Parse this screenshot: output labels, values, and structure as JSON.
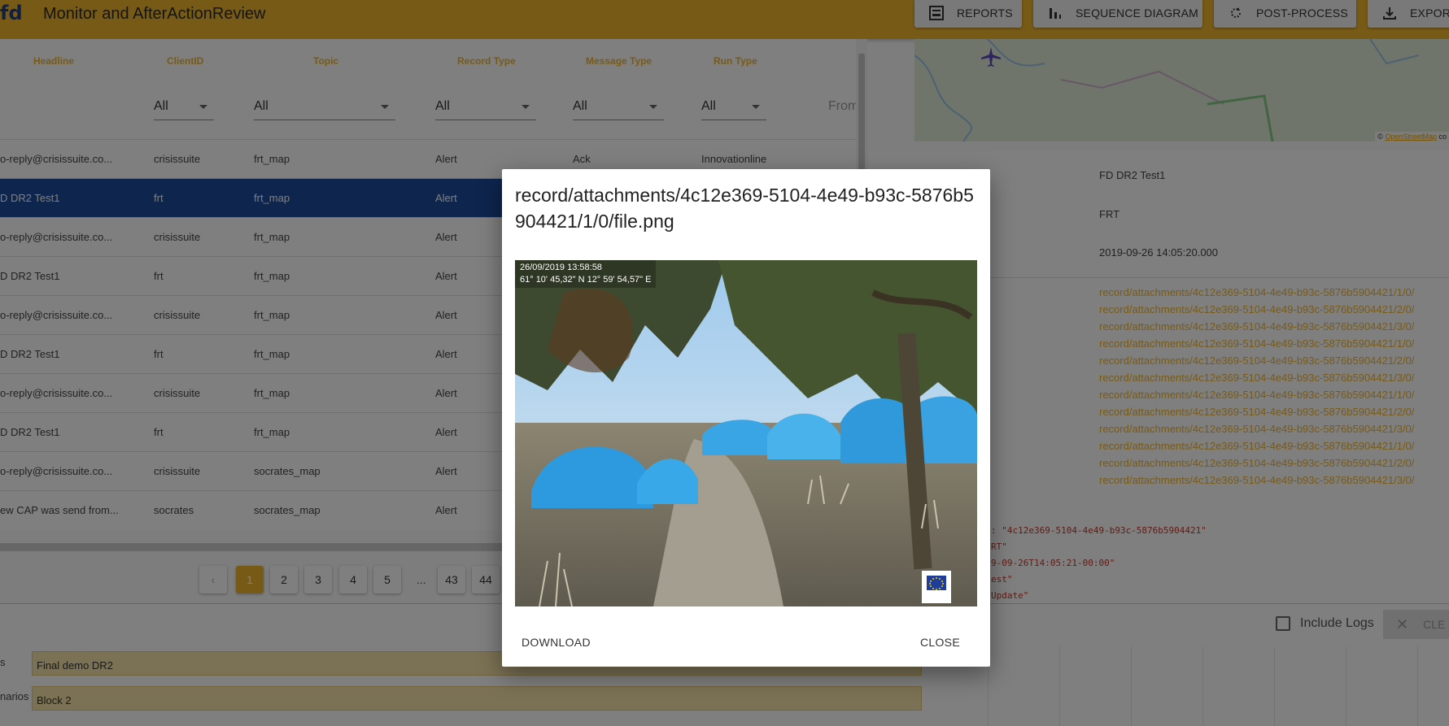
{
  "app": {
    "logo_text": "fd",
    "title": "Monitor and AfterActionReview"
  },
  "toolbar": {
    "reports": "REPORTS",
    "sequence_diagram": "SEQUENCE DIAGRAM",
    "post_process": "POST-PROCESS",
    "export": "EXPOR"
  },
  "table": {
    "columns": [
      "Headline",
      "ClientID",
      "Topic",
      "Record Type",
      "Message Type",
      "Run Type"
    ],
    "filters": {
      "clientid": "All",
      "topic": "All",
      "record_type": "All",
      "message_type": "All",
      "run_type": "All",
      "from": "From"
    },
    "rows": [
      {
        "headline": "o-reply@crisissuite.co...",
        "clientid": "crisissuite",
        "topic": "frt_map",
        "record_type": "Alert",
        "message_type": "Ack",
        "run_type": "Innovationline"
      },
      {
        "headline": "D DR2 Test1",
        "clientid": "frt",
        "topic": "frt_map",
        "record_type": "Alert",
        "message_type": "",
        "run_type": ""
      },
      {
        "headline": "o-reply@crisissuite.co...",
        "clientid": "crisissuite",
        "topic": "frt_map",
        "record_type": "Alert",
        "message_type": "",
        "run_type": ""
      },
      {
        "headline": "D DR2 Test1",
        "clientid": "frt",
        "topic": "frt_map",
        "record_type": "Alert",
        "message_type": "",
        "run_type": ""
      },
      {
        "headline": "o-reply@crisissuite.co...",
        "clientid": "crisissuite",
        "topic": "frt_map",
        "record_type": "Alert",
        "message_type": "",
        "run_type": ""
      },
      {
        "headline": "D DR2 Test1",
        "clientid": "frt",
        "topic": "frt_map",
        "record_type": "Alert",
        "message_type": "",
        "run_type": ""
      },
      {
        "headline": "o-reply@crisissuite.co...",
        "clientid": "crisissuite",
        "topic": "frt_map",
        "record_type": "Alert",
        "message_type": "",
        "run_type": ""
      },
      {
        "headline": "D DR2 Test1",
        "clientid": "frt",
        "topic": "frt_map",
        "record_type": "Alert",
        "message_type": "",
        "run_type": ""
      },
      {
        "headline": "o-reply@crisissuite.co...",
        "clientid": "crisissuite",
        "topic": "socrates_map",
        "record_type": "Alert",
        "message_type": "",
        "run_type": ""
      },
      {
        "headline": "ew CAP was send from...",
        "clientid": "socrates",
        "topic": "socrates_map",
        "record_type": "Alert",
        "message_type": "",
        "run_type": ""
      }
    ]
  },
  "pagination": {
    "prev": "‹",
    "pages": [
      "1",
      "2",
      "3",
      "4",
      "5",
      "...",
      "43",
      "44"
    ],
    "active": "1"
  },
  "timeline": {
    "labels": [
      "s",
      "narios"
    ],
    "bars": [
      "Final demo DR2",
      "Block 2"
    ]
  },
  "details": {
    "name": "FD DR2 Test1",
    "client": "FRT",
    "timestamp": "2019-09-26 14:05:20.000",
    "attachments": [
      "record/attachments/4c12e369-5104-4e49-b93c-5876b5904421/1/0/",
      "record/attachments/4c12e369-5104-4e49-b93c-5876b5904421/2/0/",
      "record/attachments/4c12e369-5104-4e49-b93c-5876b5904421/3/0/",
      "record/attachments/4c12e369-5104-4e49-b93c-5876b5904421/1/0/",
      "record/attachments/4c12e369-5104-4e49-b93c-5876b5904421/2/0/",
      "record/attachments/4c12e369-5104-4e49-b93c-5876b5904421/3/0/",
      "record/attachments/4c12e369-5104-4e49-b93c-5876b5904421/1/0/",
      "record/attachments/4c12e369-5104-4e49-b93c-5876b5904421/2/0/",
      "record/attachments/4c12e369-5104-4e49-b93c-5876b5904421/3/0/",
      "record/attachments/4c12e369-5104-4e49-b93c-5876b5904421/1/0/",
      "record/attachments/4c12e369-5104-4e49-b93c-5876b5904421/2/0/",
      "record/attachments/4c12e369-5104-4e49-b93c-5876b5904421/3/0/"
    ],
    "json_lines": [
      ": \"4c12e369-5104-4e49-b93c-5876b5904421\"",
      "RT\"",
      "9-09-26T14:05:21-00:00\"",
      "est\"",
      "Update\""
    ],
    "include_logs": "Include Logs",
    "clear": "CLE"
  },
  "map": {
    "attribution_prefix": "© ",
    "attribution_link": "OpenStreetMap",
    "attribution_suffix": " co"
  },
  "dialog": {
    "title": "record/attachments/4c12e369-5104-4e49-b93c-5876b5904421/1/0/file.png",
    "image_caption_line1": "26/09/2019 13:58:58",
    "image_caption_line2": "61° 10' 45,32\" N 12° 59' 54,57\" E",
    "eu_text": "European Commission",
    "download": "DOWNLOAD",
    "close": "CLOSE"
  },
  "colors": {
    "accent": "#f0b52f",
    "selected_row": "#1d4b9c",
    "link": "#f0b52f"
  }
}
